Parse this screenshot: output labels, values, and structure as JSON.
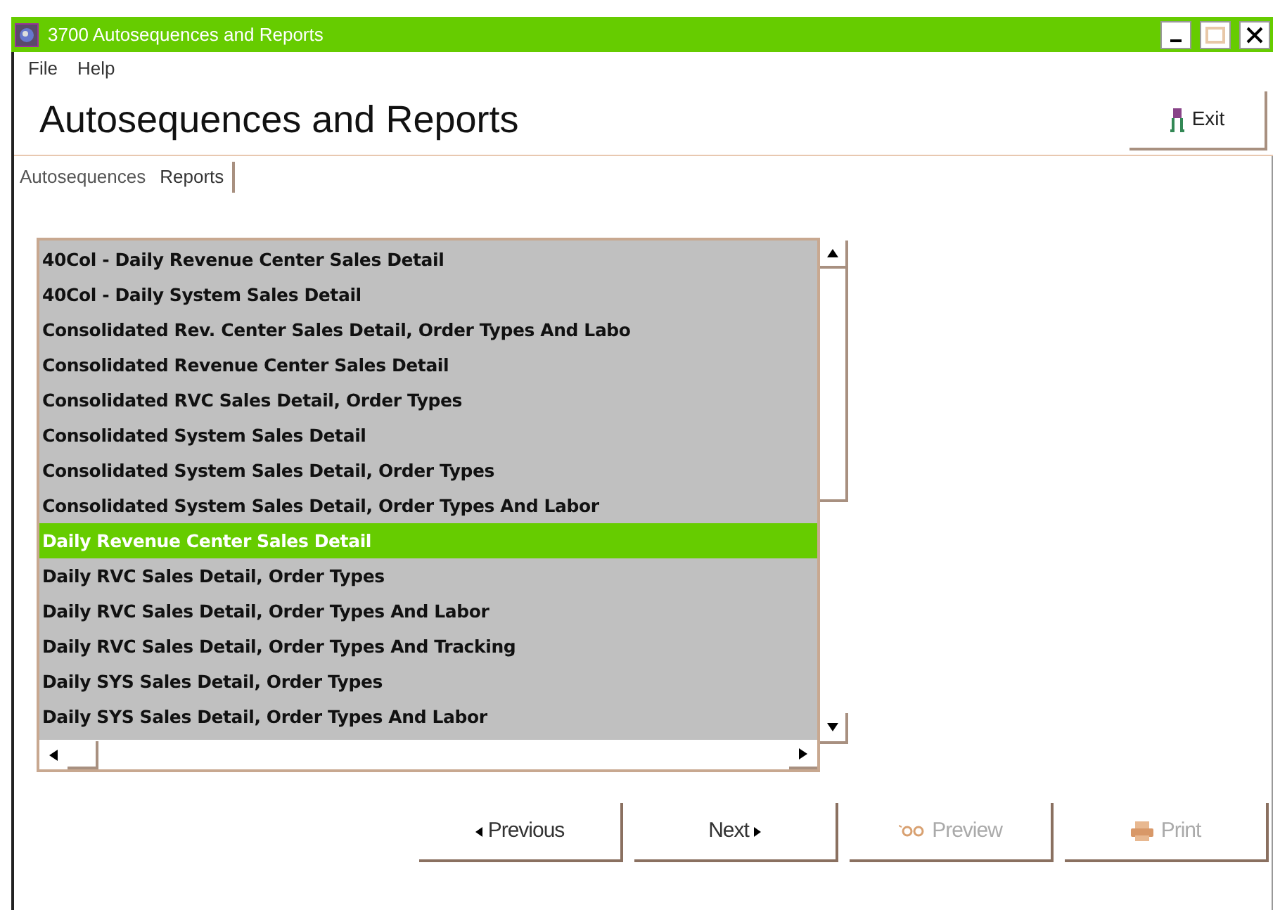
{
  "window": {
    "title": "3700 Autosequences and Reports"
  },
  "menu": [
    "File",
    "Help"
  ],
  "header": {
    "title": "Autosequences and Reports",
    "exit_button": "Exit"
  },
  "tabs": [
    {
      "label": "Autosequences",
      "selected": false
    },
    {
      "label": "Reports",
      "selected": true
    }
  ],
  "reports": [
    {
      "label": "40Col - Daily Revenue Center Sales Detail",
      "selected": false
    },
    {
      "label": "40Col - Daily System Sales Detail",
      "selected": false
    },
    {
      "label": "Consolidated Rev. Center Sales Detail, Order Types And Labo",
      "selected": false
    },
    {
      "label": "Consolidated Revenue Center Sales Detail",
      "selected": false
    },
    {
      "label": "Consolidated RVC Sales Detail, Order Types",
      "selected": false
    },
    {
      "label": "Consolidated System Sales Detail",
      "selected": false
    },
    {
      "label": "Consolidated System Sales Detail, Order Types",
      "selected": false
    },
    {
      "label": "Consolidated System Sales Detail, Order Types And Labor",
      "selected": false
    },
    {
      "label": "Daily Revenue Center Sales Detail",
      "selected": true
    },
    {
      "label": "Daily RVC Sales Detail, Order Types",
      "selected": false
    },
    {
      "label": "Daily RVC Sales Detail, Order Types And Labor",
      "selected": false
    },
    {
      "label": "Daily RVC Sales Detail, Order Types And Tracking",
      "selected": false
    },
    {
      "label": "Daily SYS Sales Detail, Order Types",
      "selected": false
    },
    {
      "label": "Daily SYS Sales Detail, Order Types And Labor",
      "selected": false
    }
  ],
  "buttons": [
    {
      "kind": "previous",
      "label": "Previous",
      "disabled": false
    },
    {
      "kind": "next",
      "label": "Next",
      "disabled": false
    },
    {
      "kind": "preview",
      "label": "Preview",
      "disabled": true
    },
    {
      "kind": "print",
      "label": "Print",
      "disabled": true
    }
  ]
}
